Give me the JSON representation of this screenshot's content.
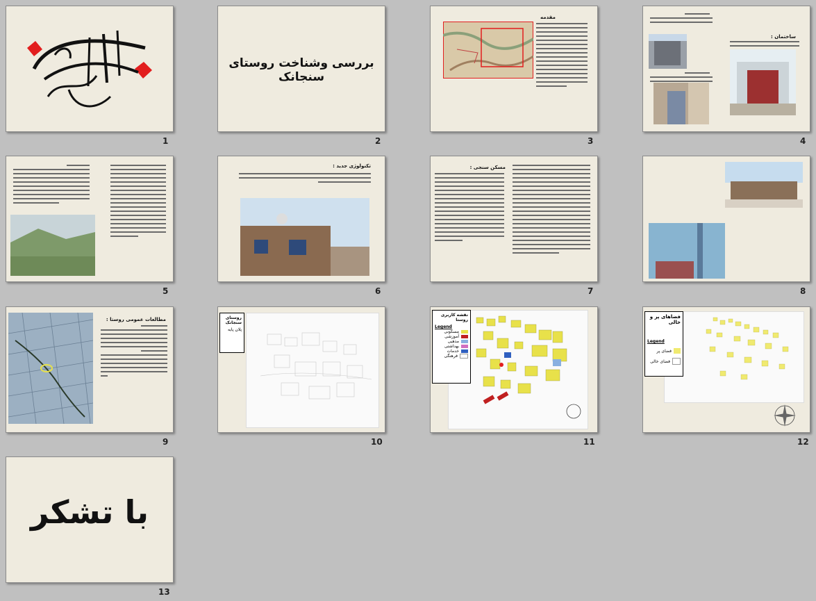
{
  "slides": [
    {
      "number": "1"
    },
    {
      "number": "2",
      "title": "بررسی وشناخت روستای سنجانک"
    },
    {
      "number": "3",
      "heading": "مقدمه"
    },
    {
      "number": "4",
      "heading": "ساختمان :"
    },
    {
      "number": "5"
    },
    {
      "number": "6",
      "heading": "تکنولوژی جدید :"
    },
    {
      "number": "7",
      "heading": "مسکن سنجی :"
    },
    {
      "number": "8"
    },
    {
      "number": "9",
      "heading": "مطالعات عمومی روستا :"
    },
    {
      "number": "10",
      "legend_title": "روستای سنجانک",
      "legend_item": "پلان پایه"
    },
    {
      "number": "11",
      "legend_title": "نقشه کاربری روستا",
      "legend_head": "Legend",
      "legend_items": [
        "مسکونی",
        "آموزشی",
        "مذهبی",
        "بهداشتی",
        "خدمات",
        "فرهنگی"
      ]
    },
    {
      "number": "12",
      "legend_title": "فضاهای پر و خالی",
      "legend_head": "Legend",
      "legend_items": [
        "فضای پر",
        "فضای خالی"
      ]
    },
    {
      "number": "13",
      "title": "با تشکر"
    }
  ],
  "colors": {
    "slide_bg": "#efebdf",
    "map_yellow": "#e8e14a",
    "calligraphy_red": "#e21e1e"
  }
}
